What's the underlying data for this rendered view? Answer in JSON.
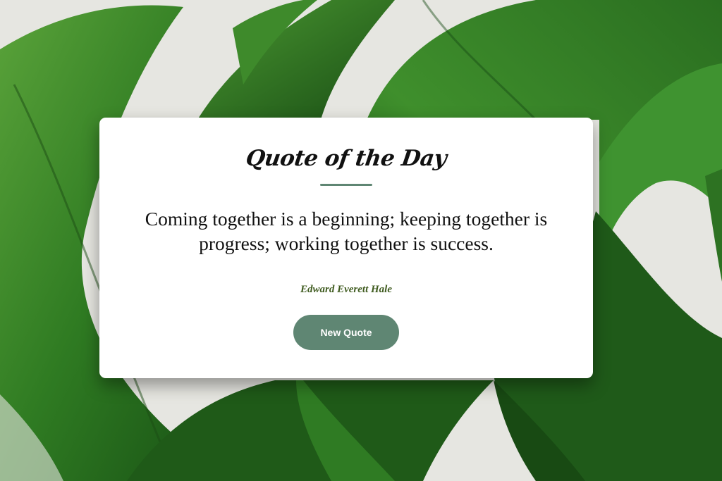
{
  "card": {
    "title": "Quote of the Day",
    "quote": "Coming together is a beginning; keeping together is progress; working together is success.",
    "author": "Edward Everett Hale",
    "button_label": "New Quote"
  },
  "colors": {
    "accent": "#5f8673",
    "author": "#3f5b1f",
    "card_background": "#ffffff",
    "leaf_dark": "#1e5a1a",
    "leaf_light": "#4f9a34"
  },
  "background": {
    "icon": "monstera-leaf-photo"
  }
}
